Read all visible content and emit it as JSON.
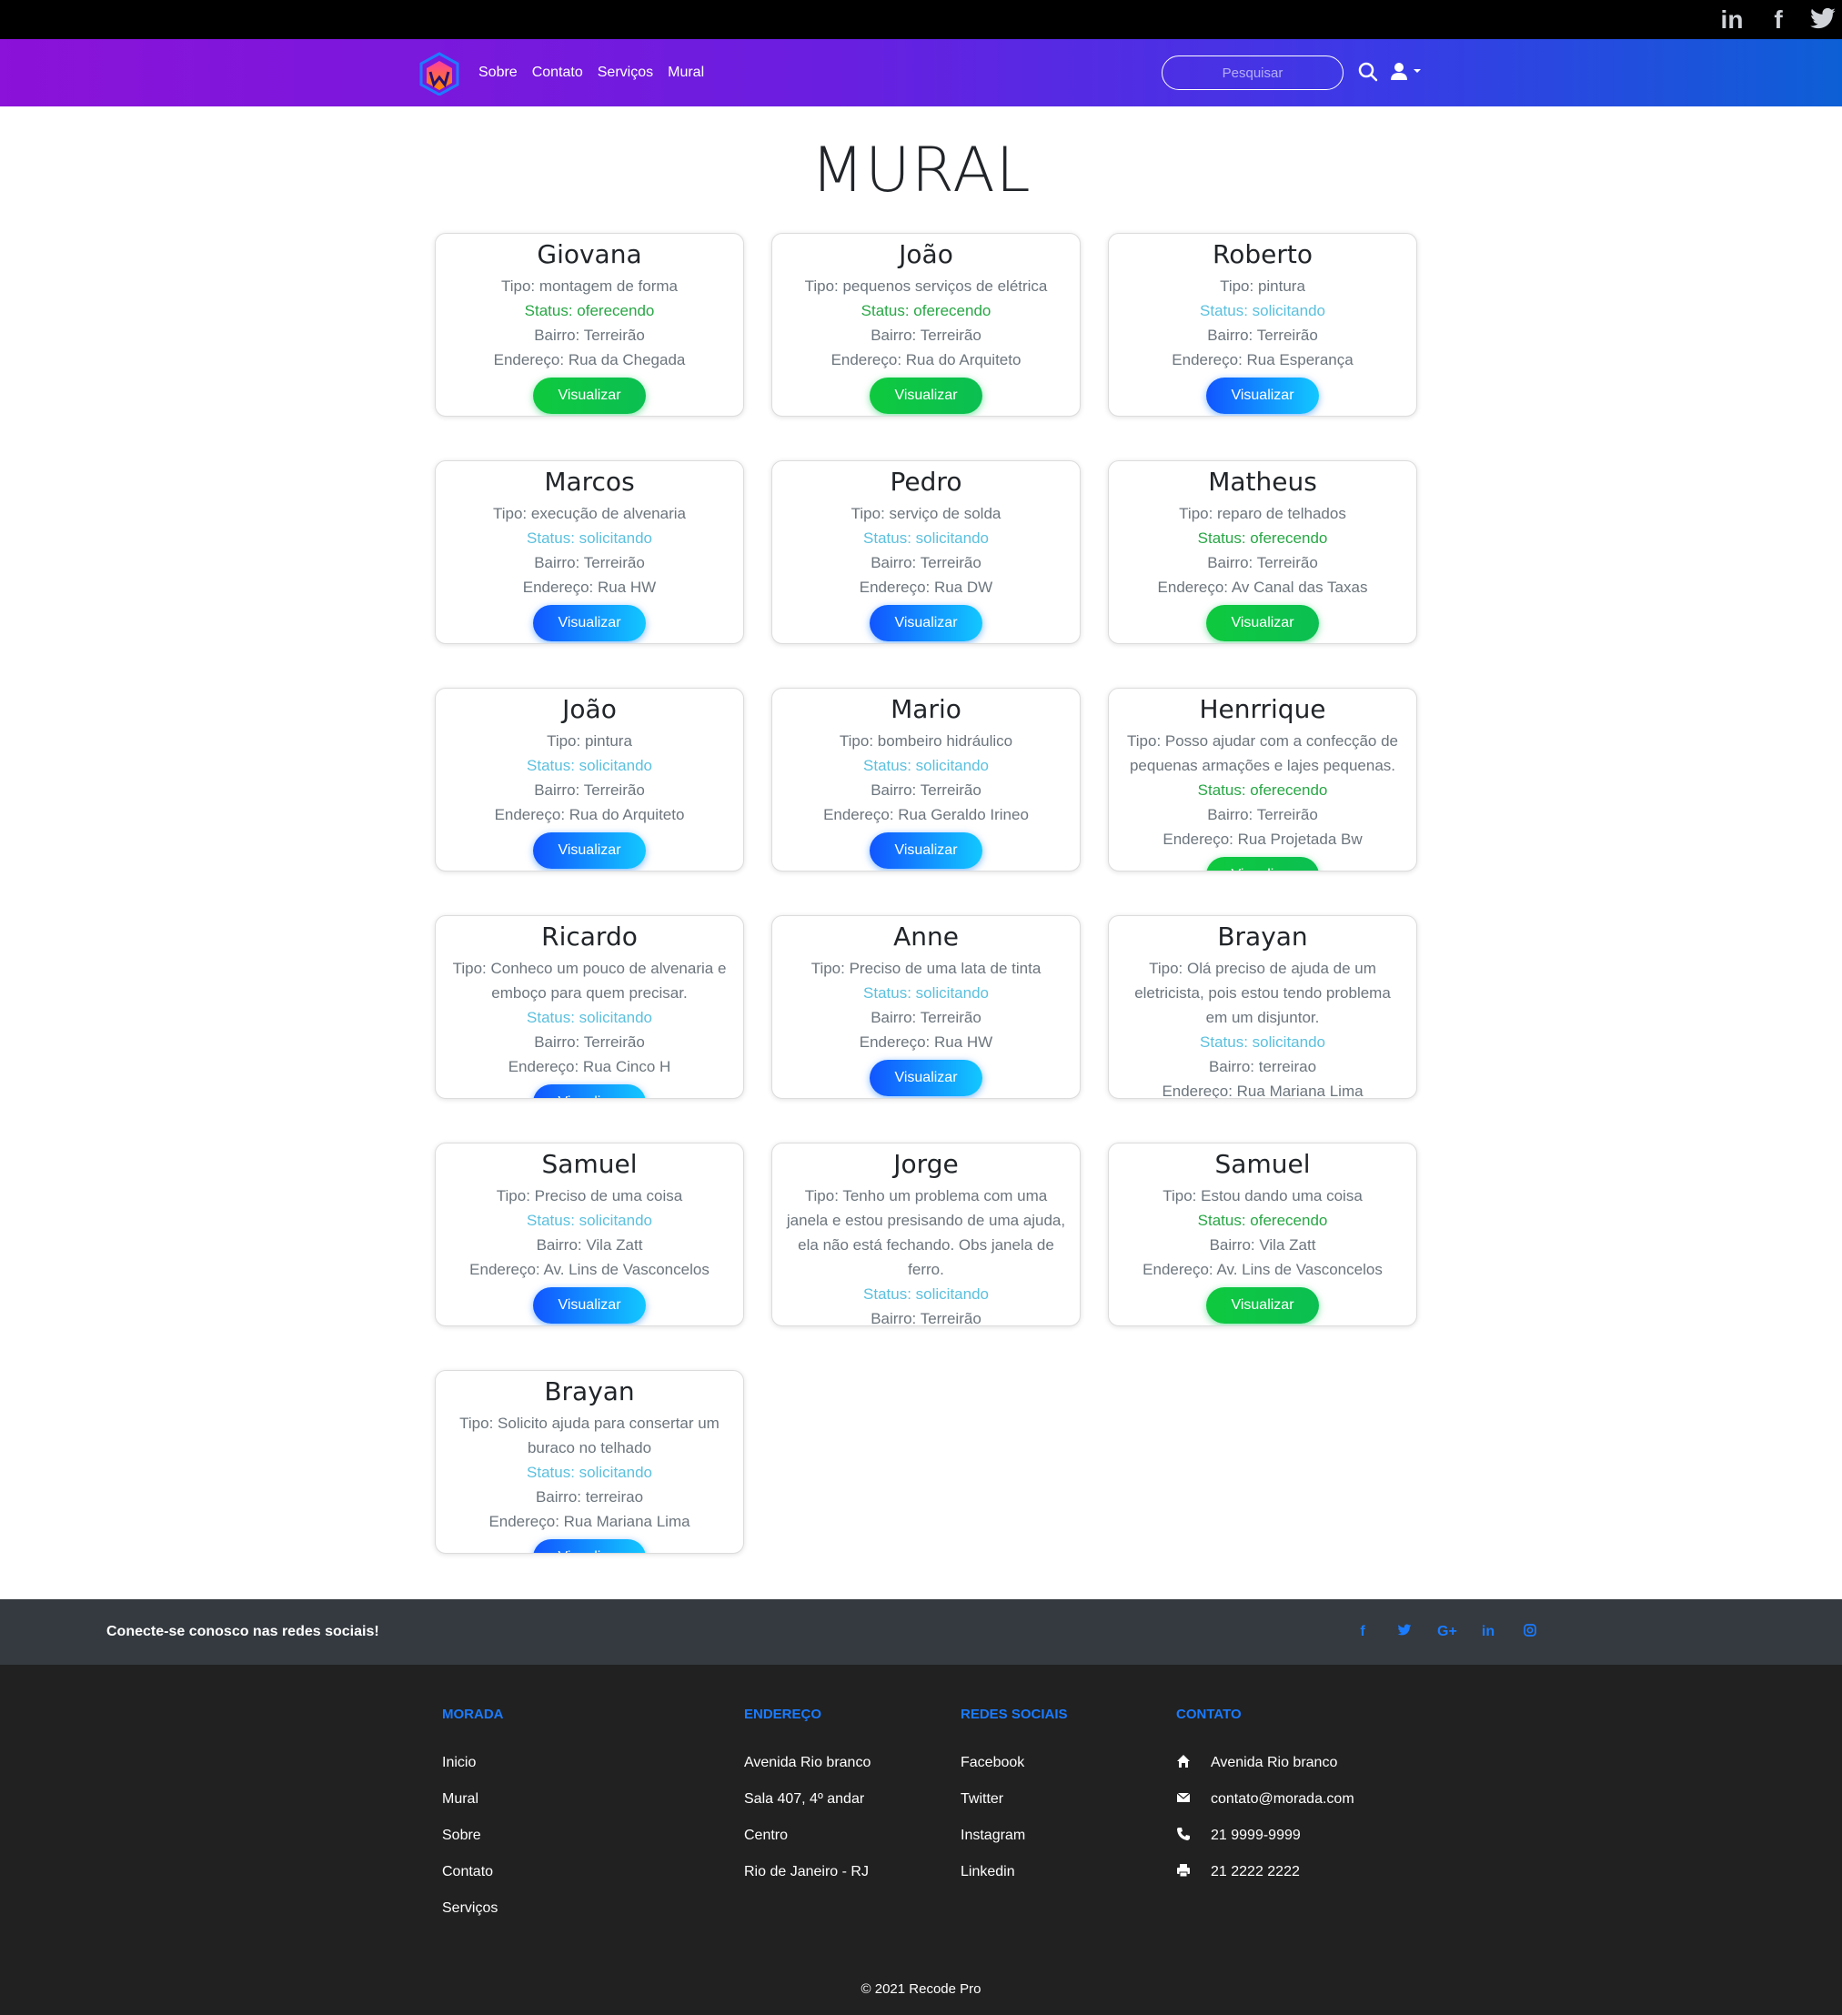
{
  "topbar": {
    "social_icons": [
      "linkedin-icon",
      "facebook-icon",
      "twitter-icon"
    ],
    "linkedin_label": "in",
    "facebook_label": "f"
  },
  "nav": {
    "links": [
      "Sobre",
      "Contato",
      "Serviços",
      "Mural"
    ],
    "search_placeholder": "Pesquisar"
  },
  "main": {
    "title": "MURAL",
    "button_label": "Visualizar",
    "cards": [
      {
        "name": "Giovana",
        "lines": [
          "Tipo: montagem de forma"
        ],
        "status": "Status: oferecendo",
        "status_type": "oferecendo",
        "bairro": "Bairro: Terreirão",
        "endereco": "Endereço: Rua da Chegada"
      },
      {
        "name": "João",
        "lines": [
          "Tipo: pequenos serviços de elétrica"
        ],
        "status": "Status: oferecendo",
        "status_type": "oferecendo",
        "bairro": "Bairro: Terreirão",
        "endereco": "Endereço: Rua do Arquiteto"
      },
      {
        "name": "Roberto",
        "lines": [
          "Tipo: pintura"
        ],
        "status": "Status: solicitando",
        "status_type": "solicitando",
        "bairro": "Bairro: Terreirão",
        "endereco": "Endereço: Rua Esperança"
      },
      {
        "name": "Marcos",
        "lines": [
          "Tipo: execução de alvenaria"
        ],
        "status": "Status: solicitando",
        "status_type": "solicitando",
        "bairro": "Bairro: Terreirão",
        "endereco": "Endereço: Rua HW"
      },
      {
        "name": "Pedro",
        "lines": [
          "Tipo: serviço de solda"
        ],
        "status": "Status: solicitando",
        "status_type": "solicitando",
        "bairro": "Bairro: Terreirão",
        "endereco": "Endereço: Rua DW"
      },
      {
        "name": "Matheus",
        "lines": [
          "Tipo: reparo de telhados"
        ],
        "status": "Status: oferecendo",
        "status_type": "oferecendo",
        "bairro": "Bairro: Terreirão",
        "endereco": "Endereço: Av Canal das Taxas"
      },
      {
        "name": "João",
        "lines": [
          "Tipo: pintura"
        ],
        "status": "Status: solicitando",
        "status_type": "solicitando",
        "bairro": "Bairro: Terreirão",
        "endereco": "Endereço: Rua do Arquiteto"
      },
      {
        "name": "Mario",
        "lines": [
          "Tipo: bombeiro hidráulico"
        ],
        "status": "Status: solicitando",
        "status_type": "solicitando",
        "bairro": "Bairro: Terreirão",
        "endereco": "Endereço: Rua Geraldo Irineo"
      },
      {
        "name": "Henrrique",
        "lines": [
          "Tipo: Posso ajudar com a confecção de",
          "pequenas armações e lajes pequenas."
        ],
        "status": "Status: oferecendo",
        "status_type": "oferecendo",
        "bairro": "Bairro: Terreirão",
        "endereco": "Endereço: Rua Projetada Bw"
      },
      {
        "name": "Ricardo",
        "lines": [
          "Tipo: Conheco um pouco de alvenaria e",
          "emboço para quem precisar."
        ],
        "status": "Status: solicitando",
        "status_type": "solicitando",
        "bairro": "Bairro: Terreirão",
        "endereco": "Endereço: Rua Cinco H"
      },
      {
        "name": "Anne",
        "lines": [
          "Tipo: Preciso de uma lata de tinta"
        ],
        "status": "Status: solicitando",
        "status_type": "solicitando",
        "bairro": "Bairro: Terreirão",
        "endereco": "Endereço: Rua HW"
      },
      {
        "name": "Brayan",
        "lines": [
          "Tipo: Olá preciso de ajuda de um",
          "eletricista, pois estou tendo problema",
          "em um disjuntor."
        ],
        "status": "Status: solicitando",
        "status_type": "solicitando",
        "bairro": "Bairro: terreirao",
        "endereco": "Endereço: Rua Mariana Lima"
      },
      {
        "name": "Samuel",
        "lines": [
          "Tipo: Preciso de uma coisa"
        ],
        "status": "Status: solicitando",
        "status_type": "solicitando",
        "bairro": "Bairro: Vila Zatt",
        "endereco": "Endereço: Av. Lins de Vasconcelos"
      },
      {
        "name": "Jorge",
        "lines": [
          "Tipo: Tenho um problema com uma",
          "janela e estou presisando de uma ajuda,",
          "ela não está fechando. Obs janela de",
          "ferro."
        ],
        "status": "Status: solicitando",
        "status_type": "solicitando",
        "bairro": "Bairro: Terreirão",
        "endereco": ""
      },
      {
        "name": "Samuel",
        "lines": [
          "Tipo: Estou dando uma coisa"
        ],
        "status": "Status: oferecendo",
        "status_type": "oferecendo",
        "bairro": "Bairro: Vila Zatt",
        "endereco": "Endereço: Av. Lins de Vasconcelos"
      },
      {
        "name": "Brayan",
        "lines": [
          "Tipo: Solicito ajuda para consertar um",
          "buraco no telhado"
        ],
        "status": "Status: solicitando",
        "status_type": "solicitando",
        "bairro": "Bairro: terreirao",
        "endereco": "Endereço: Rua Mariana Lima"
      }
    ]
  },
  "social_strip": {
    "text": "Conecte-se conosco nas redes sociais!",
    "icons": [
      {
        "name": "facebook-icon",
        "glyph": "f"
      },
      {
        "name": "twitter-icon",
        "glyph": "🐦"
      },
      {
        "name": "google-plus-icon",
        "glyph": "G+"
      },
      {
        "name": "linkedin-icon",
        "glyph": "in"
      },
      {
        "name": "instagram-icon",
        "glyph": "◎"
      }
    ]
  },
  "footer": {
    "columns": [
      {
        "title": "MORADA",
        "items": [
          "Inicio",
          "Mural",
          "Sobre",
          "Contato",
          "Serviços"
        ]
      },
      {
        "title": "ENDEREÇO",
        "items": [
          "Avenida Rio branco",
          "Sala 407, 4º andar",
          "Centro",
          "Rio de Janeiro - RJ"
        ]
      },
      {
        "title": "REDES SOCIAIS",
        "items": [
          "Facebook",
          "Twitter",
          "Instagram",
          "Linkedin"
        ]
      },
      {
        "title": "CONTATO",
        "items": [
          {
            "icon": "home-icon",
            "text": "Avenida Rio branco"
          },
          {
            "icon": "envelope-icon",
            "text": "contato@morada.com"
          },
          {
            "icon": "phone-icon",
            "text": "21 9999-9999"
          },
          {
            "icon": "printer-icon",
            "text": "21 2222 2222"
          }
        ]
      }
    ],
    "copyright": "© 2021 Recode Pro"
  },
  "colors": {
    "nav_start": "#8b12d8",
    "nav_end": "#0d5fd6",
    "status_oferecendo": "#28a745",
    "status_solicitando": "#5bc0de",
    "footer_heading": "#1a7bff"
  }
}
